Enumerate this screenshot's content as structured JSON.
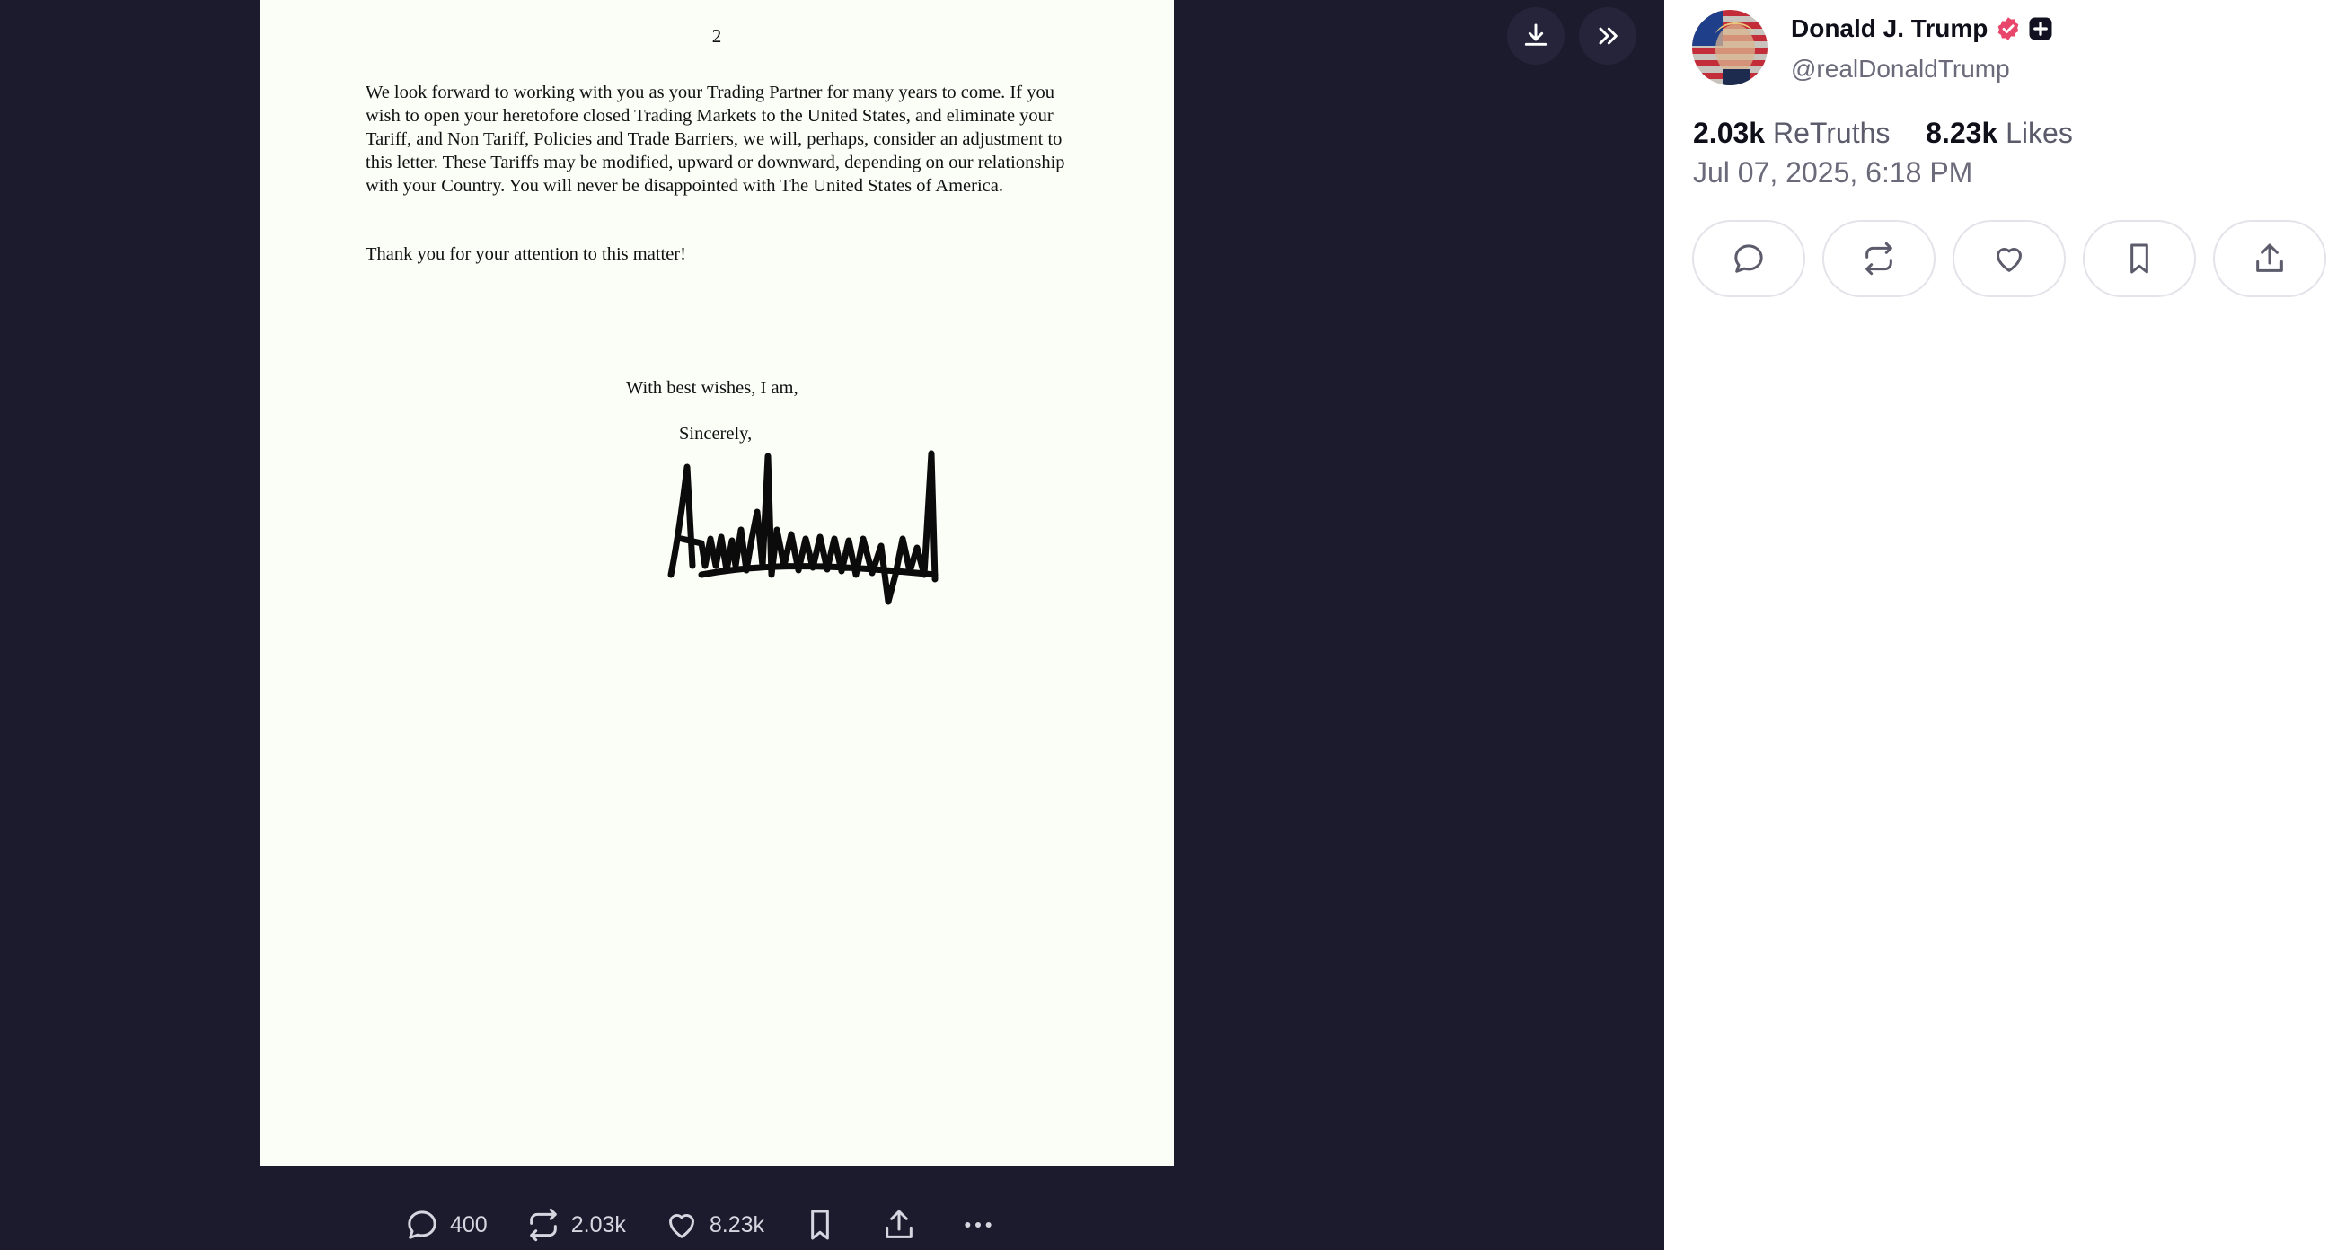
{
  "letter": {
    "page_number": "2",
    "paragraph_1": "We look forward to working with you as your Trading Partner for many years to come. If you wish to open your heretofore closed Trading Markets to the United States, and eliminate your Tariff, and Non Tariff, Policies and Trade Barriers, we will, perhaps, consider an adjustment to this letter. These Tariffs may be modified, upward or downward, depending on our relationship with your Country. You will never be disappointed with The United States of America.",
    "paragraph_2": "Thank you for your attention to this matter!",
    "closing": "With best wishes, I am,",
    "sign_off": "Sincerely,"
  },
  "viewer_controls": {
    "download_icon": "download-icon",
    "expand_icon": "chevrons-right-icon"
  },
  "action_bar": {
    "replies": "400",
    "retruths": "2.03k",
    "likes": "8.23k",
    "icons": [
      "comment-icon",
      "retruth-icon",
      "heart-icon",
      "bookmark-icon",
      "share-icon",
      "more-icon"
    ]
  },
  "author": {
    "name": "Donald J. Trump",
    "handle": "@realDonaldTrump",
    "verified_color": "#e8466b"
  },
  "stats": {
    "retruths_count": "2.03k",
    "retruths_label": "ReTruths",
    "likes_count": "8.23k",
    "likes_label": "Likes"
  },
  "post_date": "Jul 07, 2025, 6:18 PM",
  "colors": {
    "viewer_bg": "#1c1b2e",
    "panel_bg": "#ffffff",
    "paper": "#fbfdf7",
    "icon": "#5b5b6b"
  }
}
